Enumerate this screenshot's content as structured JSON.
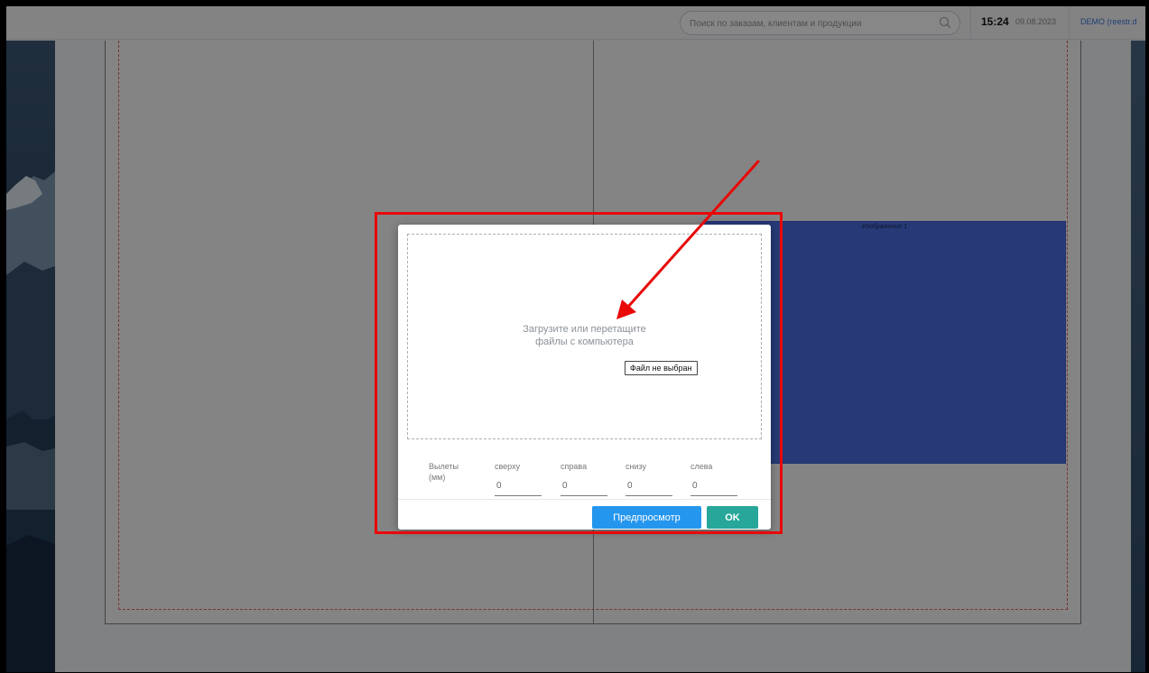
{
  "header": {
    "search_placeholder": "Поиск по заказам, клиентам и продукции",
    "search_icon": "search-icon",
    "time": "15:24",
    "date": "09.08.2023",
    "user": "DEMO (reestr.d"
  },
  "canvas": {
    "image_label": "Изображение 1"
  },
  "modal": {
    "drop_text_line1": "Загрузите или перетащите",
    "drop_text_line2": "файлы с компьютера",
    "file_button_label": "Файл не выбран",
    "bleeds_label_line1": "Вылеты",
    "bleeds_label_line2": "(мм)",
    "bleeds": [
      {
        "label": "сверху",
        "value": "0"
      },
      {
        "label": "справа",
        "value": "0"
      },
      {
        "label": "снизу",
        "value": "0"
      },
      {
        "label": "слева",
        "value": "0"
      }
    ],
    "preview_label": "Предпросмотр",
    "ok_label": "OK"
  },
  "colors": {
    "accent_blue": "#2496ee",
    "ok_green": "#26a79a",
    "annotation_red": "#e80808",
    "image_block_blue": "#4a6ee0"
  }
}
